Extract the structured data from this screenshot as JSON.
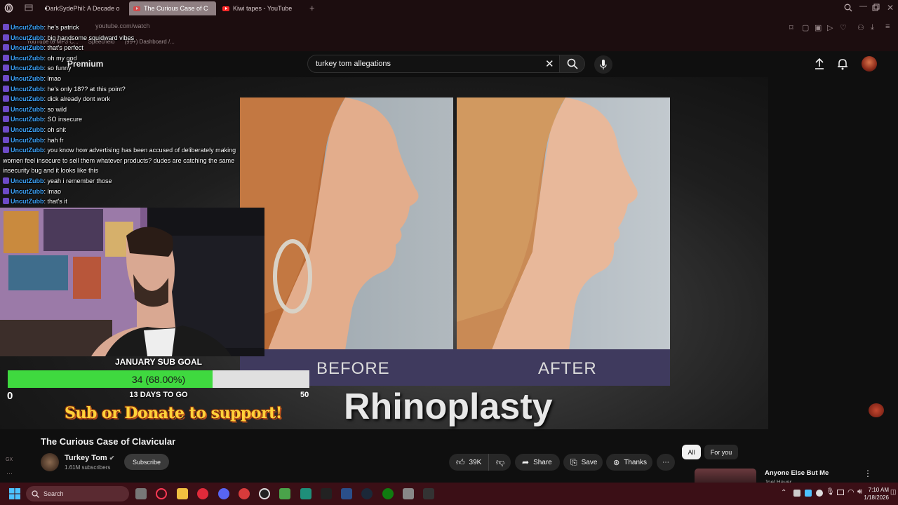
{
  "browser": {
    "tabs": [
      {
        "label": "DarkSydePhil: A Decade o",
        "active": false
      },
      {
        "label": "The Curious Case of C",
        "active": true
      },
      {
        "label": "Kiwi tapes - YouTube",
        "active": false
      }
    ],
    "url": "youtube.com/watch",
    "bookmarks": [
      "YouTube to MP3 C...",
      "Speechelo",
      "(99+) Dashboard /..."
    ],
    "sidebar_label": "GX"
  },
  "youtube": {
    "logo_text": "Premium",
    "search_value": "turkey tom allegations",
    "video": {
      "before_label": "BEFORE",
      "after_label": "AFTER",
      "overlay_text": "Rhinoplasty"
    },
    "title": "The Curious Case of Clavicular",
    "channel": {
      "name": "Turkey Tom",
      "subscribers": "1.61M subscribers",
      "subscribe_label": "Subscribe"
    },
    "actions": {
      "likes": "39K",
      "share": "Share",
      "save": "Save",
      "thanks": "Thanks"
    },
    "filters": [
      "All",
      "For you"
    ],
    "up_next": {
      "title": "Anyone Else But Me",
      "channel": "Joel Haver"
    }
  },
  "chat": [
    {
      "user": "UncutZubb",
      "msg": "he's patrick"
    },
    {
      "user": "UncutZubb",
      "msg": "big handsome squidward vibes"
    },
    {
      "user": "UncutZubb",
      "msg": "that's perfect"
    },
    {
      "user": "UncutZubb",
      "msg": "oh my god"
    },
    {
      "user": "UncutZubb",
      "msg": "so funny"
    },
    {
      "user": "UncutZubb",
      "msg": "lmao"
    },
    {
      "user": "UncutZubb",
      "msg": "he's only 18?? at this point?"
    },
    {
      "user": "UncutZubb",
      "msg": "dick already dont work"
    },
    {
      "user": "UncutZubb",
      "msg": "so wild"
    },
    {
      "user": "UncutZubb",
      "msg": "SO insecure"
    },
    {
      "user": "UncutZubb",
      "msg": "oh shit"
    },
    {
      "user": "UncutZubb",
      "msg": "hah fr"
    },
    {
      "user": "UncutZubb",
      "msg": "you know how advertising has been accused of deliberately making women feel insecure to sell them whatever products? dudes are catching the same insecurity bug and it looks like this"
    },
    {
      "user": "UncutZubb",
      "msg": "yeah i remember those"
    },
    {
      "user": "UncutZubb",
      "msg": "lmao"
    },
    {
      "user": "UncutZubb",
      "msg": "that's it"
    }
  ],
  "sub_goal": {
    "title": "JANUARY SUB GOAL",
    "progress_text": "34 (68.00%)",
    "progress_fraction": 0.68,
    "days_left": "13 DAYS TO GO",
    "min": "0",
    "max": "50",
    "support_text": "Sub or Donate to support!"
  },
  "taskbar": {
    "search_placeholder": "Search",
    "time": "7:10 AM",
    "date": "1/18/2026"
  },
  "colors": {
    "browser_chrome": "#1c0d0f",
    "taskbar": "#3b0f16",
    "goal_fill": "#3fd93f",
    "caption_bar": "#3f3a5e",
    "chat_user": "#3fa7ff"
  }
}
